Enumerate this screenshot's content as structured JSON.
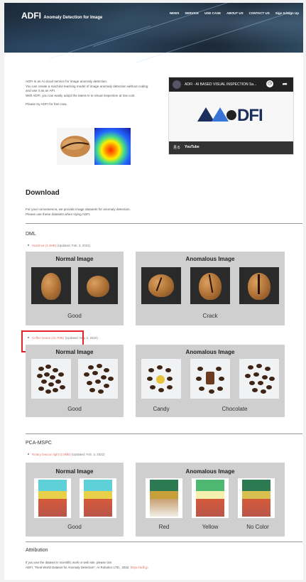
{
  "header": {
    "logo_main": "ADFI",
    "logo_sub": "Anomaly Detection for Image",
    "nav": [
      "NEWS",
      "SERVICE",
      "USE CASE",
      "ABOUT US",
      "CONTACT US",
      "Sign In/Sign Up"
    ]
  },
  "intro": {
    "lines": [
      "ADFI is an AI cloud service for image anomaly detection.",
      "You can create a machine learning model of image anomaly detection without coding and use it as an API.",
      "With ADFI, you can easily adopt the latest AI to visual inspection at low cost.",
      "Please try ADFI for free now."
    ]
  },
  "video": {
    "title": "ADFI - AI BASED VISUAL INSPECTION Sa...",
    "brand": "DFI",
    "watch_on": "見る",
    "youtube": "YouTube"
  },
  "download": {
    "heading": "Download",
    "desc": [
      "For your convenience, we provide image datasets for anomaly detection.",
      "Please use these datasets when trying ADFI."
    ]
  },
  "dml": {
    "heading": "DML",
    "datasets": [
      {
        "link": "Hazelnut (4.4MB)",
        "updated": "(Updated: Feb. 3, 2022)",
        "normal_title": "Normal Image",
        "anomalous_title": "Anomalous Image",
        "normal_label": "Good",
        "anomalous_labels": [
          "Crack"
        ]
      },
      {
        "link": "Coffee beans (22.7MB)",
        "updated": "(Updated: May 2, 2022)",
        "normal_title": "Normal Image",
        "anomalous_title": "Anomalous Image",
        "normal_label": "Good",
        "anomalous_labels": [
          "Candy",
          "Chocolate"
        ]
      }
    ]
  },
  "pca": {
    "heading": "PCA-MSPC",
    "dataset": {
      "link": "Rotary beacon light (2.9MB)",
      "updated": "(Updated: Feb. 3, 2022)",
      "normal_title": "Normal Image",
      "anomalous_title": "Anomalous Image",
      "normal_label": "Good",
      "anomalous_labels": [
        "Red",
        "Yellow",
        "No Color"
      ]
    }
  },
  "attribution": {
    "heading": "Attribution",
    "line1": "If you use the dataset in scientific work or web site, please cite:",
    "line2": "ADFI, \"Real-World Dataset for Anomaly Detection\", AI Robotics LTD., 2022,",
    "link": "https://adfi.jp"
  },
  "colors": {
    "link": "#e0766b",
    "highlight_box": "#e2232a",
    "panel_bg": "#cfcfcf"
  }
}
